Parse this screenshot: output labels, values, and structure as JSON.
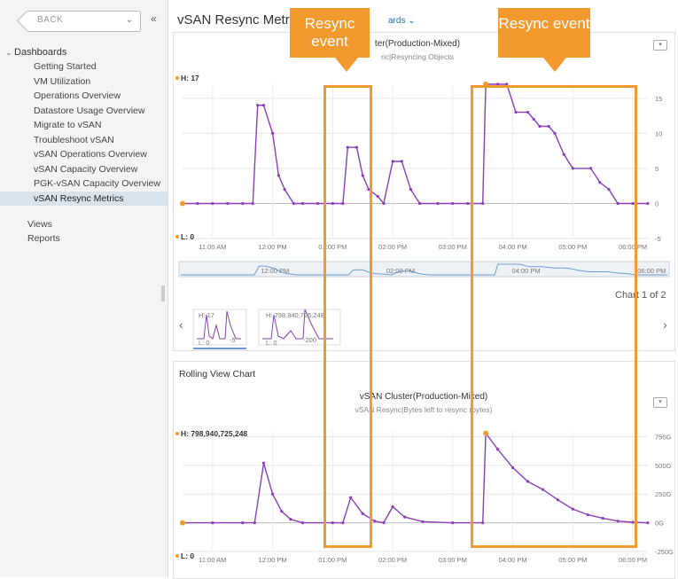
{
  "sidebar": {
    "back_label": "BACK",
    "collapse_glyph": "«",
    "section_label": "Dashboards",
    "items": [
      {
        "label": "Getting Started"
      },
      {
        "label": "VM Utilization"
      },
      {
        "label": "Operations Overview"
      },
      {
        "label": "Datastore Usage Overview"
      },
      {
        "label": "Migrate to vSAN"
      },
      {
        "label": "Troubleshoot vSAN"
      },
      {
        "label": "vSAN Operations Overview"
      },
      {
        "label": "vSAN Capacity Overview"
      },
      {
        "label": "PGK-vSAN Capacity Overview"
      },
      {
        "label": "vSAN Resync Metrics",
        "active": true
      }
    ],
    "views_label": "Views",
    "reports_label": "Reports"
  },
  "main": {
    "title": "vSAN Resync Metrics",
    "dashboards_link": "ards ⌄",
    "chart1": {
      "title": "ter(Production-Mixed)",
      "subtitle": "nc|Resyncing Objects",
      "high_label": "H: 17",
      "low_label": "L: 0",
      "counter": "Chart 1 of 2",
      "thumb2_high": "H: 798,940,725,248",
      "thumb1_tick": "-5",
      "thumb2_tick": "-200"
    },
    "chart2": {
      "panel_title": "Rolling View Chart",
      "title": "vSAN Cluster(Production-Mixed)",
      "subtitle": "vSAN Resync|Bytes left to resync (bytes)",
      "high_label": "H: 798,940,725,248",
      "low_label": "L: 0"
    }
  },
  "annotations": {
    "callout_1": "Resync event",
    "callout_2": "Resync event",
    "accent_color": "#f29a2e"
  },
  "chart_data": [
    {
      "type": "line",
      "title": "",
      "xlabel": "",
      "ylabel": "",
      "x": [
        "11:00 AM",
        "12:00 PM",
        "01:00 PM",
        "02:00 PM",
        "03:00 PM",
        "04:00 PM",
        "05:00 PM",
        "06:00 PM"
      ],
      "y_ticks": [
        "15",
        "10",
        "5",
        "0",
        "-5"
      ],
      "ylim": [
        -5,
        17
      ],
      "navigator_ticks": [
        "12:00 PM",
        "02:00 PM",
        "04:00 PM",
        "06:00 PM"
      ],
      "color": "#8a3fb8",
      "series": [
        {
          "points": [
            [
              10.5,
              0
            ],
            [
              10.75,
              0
            ],
            [
              11.0,
              0
            ],
            [
              11.25,
              0
            ],
            [
              11.5,
              0
            ],
            [
              11.67,
              0
            ],
            [
              11.75,
              14
            ],
            [
              11.85,
              14
            ],
            [
              12.0,
              10
            ],
            [
              12.1,
              4
            ],
            [
              12.2,
              2
            ],
            [
              12.35,
              0
            ],
            [
              12.5,
              0
            ],
            [
              12.75,
              0
            ],
            [
              13.0,
              0
            ],
            [
              13.17,
              0
            ],
            [
              13.25,
              8
            ],
            [
              13.4,
              8
            ],
            [
              13.5,
              4
            ],
            [
              13.6,
              2
            ],
            [
              13.75,
              1
            ],
            [
              13.85,
              0
            ],
            [
              14.0,
              6
            ],
            [
              14.15,
              6
            ],
            [
              14.3,
              2
            ],
            [
              14.45,
              0
            ],
            [
              14.75,
              0
            ],
            [
              15.0,
              0
            ],
            [
              15.25,
              0
            ],
            [
              15.5,
              0
            ],
            [
              15.55,
              17
            ],
            [
              15.75,
              17
            ],
            [
              15.9,
              17
            ],
            [
              16.05,
              13
            ],
            [
              16.25,
              13
            ],
            [
              16.35,
              12
            ],
            [
              16.45,
              11
            ],
            [
              16.6,
              11
            ],
            [
              16.7,
              10
            ],
            [
              16.85,
              7
            ],
            [
              17.0,
              5
            ],
            [
              17.3,
              5
            ],
            [
              17.45,
              3
            ],
            [
              17.6,
              2
            ],
            [
              17.75,
              0
            ],
            [
              18.0,
              0
            ],
            [
              18.25,
              0
            ]
          ]
        }
      ]
    },
    {
      "type": "line",
      "title": "vSAN Cluster(Production-Mixed)",
      "xlabel": "",
      "ylabel": "",
      "x": [
        "11:00 AM",
        "12:00 PM",
        "01:00 PM",
        "02:00 PM",
        "03:00 PM",
        "04:00 PM",
        "05:00 PM",
        "06:00 PM"
      ],
      "y_ticks": [
        "750G",
        "500G",
        "250G",
        "0G",
        "-250G"
      ],
      "ylim": [
        -250,
        800
      ],
      "color": "#8a3fb8",
      "series": [
        {
          "name": "Bytes left to resync",
          "points": [
            [
              10.5,
              0
            ],
            [
              11.0,
              0
            ],
            [
              11.5,
              0
            ],
            [
              11.7,
              0
            ],
            [
              11.85,
              520
            ],
            [
              12.0,
              250
            ],
            [
              12.15,
              100
            ],
            [
              12.3,
              30
            ],
            [
              12.5,
              0
            ],
            [
              13.0,
              0
            ],
            [
              13.17,
              0
            ],
            [
              13.3,
              220
            ],
            [
              13.5,
              80
            ],
            [
              13.7,
              15
            ],
            [
              13.85,
              0
            ],
            [
              14.0,
              140
            ],
            [
              14.2,
              50
            ],
            [
              14.5,
              10
            ],
            [
              15.0,
              0
            ],
            [
              15.5,
              0
            ],
            [
              15.55,
              780
            ],
            [
              15.75,
              640
            ],
            [
              16.0,
              480
            ],
            [
              16.25,
              360
            ],
            [
              16.5,
              290
            ],
            [
              16.75,
              200
            ],
            [
              17.0,
              120
            ],
            [
              17.25,
              70
            ],
            [
              17.5,
              40
            ],
            [
              17.75,
              15
            ],
            [
              18.0,
              5
            ],
            [
              18.25,
              0
            ]
          ]
        }
      ]
    }
  ]
}
